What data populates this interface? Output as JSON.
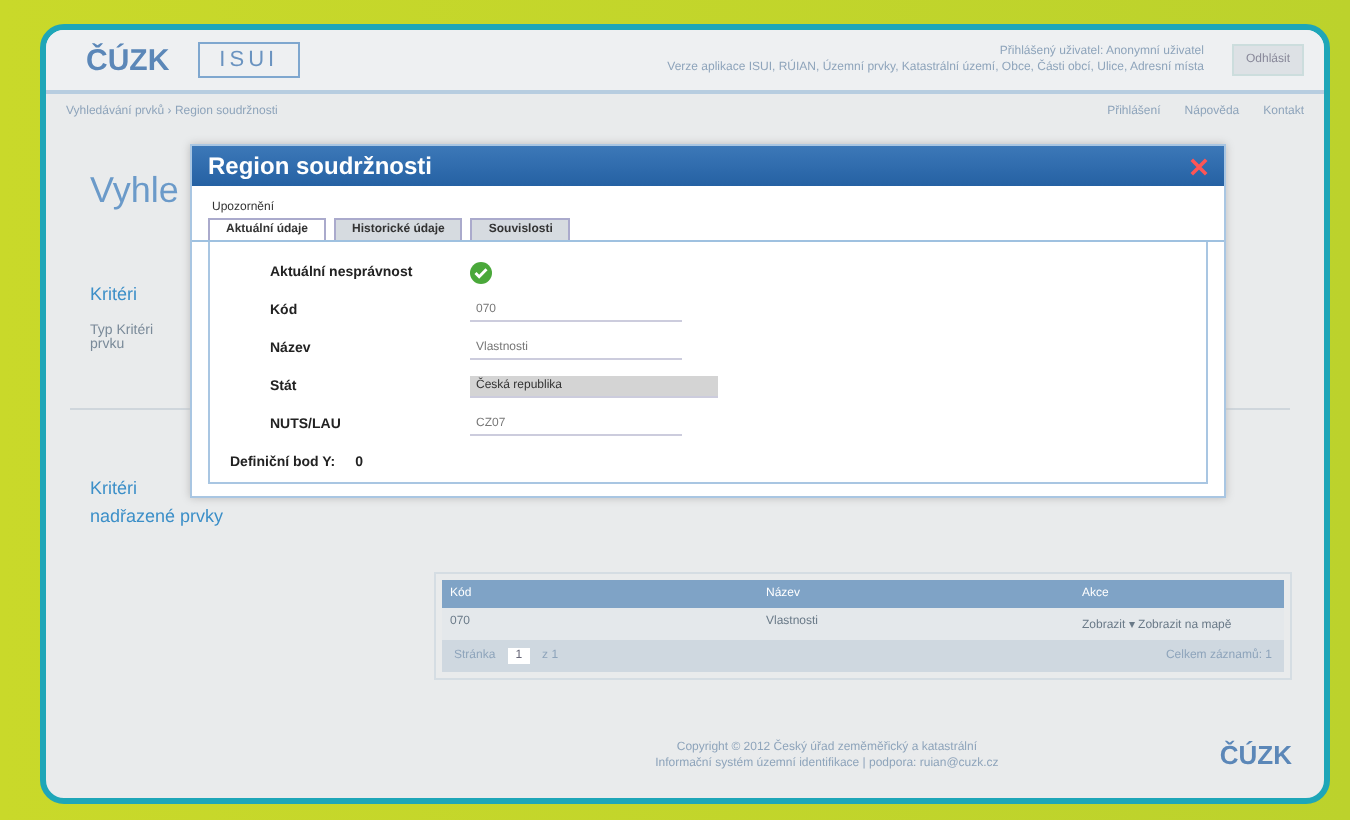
{
  "header": {
    "logo": "ČÚZK",
    "app": "ISUI",
    "info_lines": [
      "Přihlášený uživatel: Anonymní uživatel",
      "Verze aplikace ISUI, RÚIAN, Územní prvky, Katastrální území, Obce, Části obcí, Ulice, Adresní místa"
    ],
    "button": "Odhlásit"
  },
  "breadcrumb": "Vyhledávání prvků › Region soudržnosti",
  "top_links": [
    "Přihlášení",
    "Nápověda",
    "Kontakt"
  ],
  "page": {
    "title": "Vyhle",
    "criteria_link": "Kritéri",
    "criteria_text": "Typ Kritéri prvku",
    "parent_link": "Kritéri",
    "parent_text": "nadřazené prvky",
    "table": {
      "columns": [
        "Kód",
        "Název",
        "Akce"
      ],
      "rows": [
        {
          "code": "070",
          "name": "Vlastnosti",
          "action": "Zobrazit",
          "caret": "▾",
          "action2": "Zobrazit na mapě"
        }
      ],
      "pager_label": "Stránka",
      "pager_value": "1",
      "pager_total": "z 1",
      "count": "Celkem záznamů: 1"
    },
    "footer": [
      "Copyright © 2012 Český úřad zeměměřický a katastrální",
      "Informační systém územní identifikace | podpora: ruian@cuzk.cz"
    ],
    "footer_logo": "ČÚZK"
  },
  "dialog": {
    "title": "Region soudržnosti",
    "notice": "Upozornění",
    "tabs": [
      {
        "label": "Aktuální údaje",
        "selected": true
      },
      {
        "label": "Historické údaje",
        "selected": false
      },
      {
        "label": "Souvislosti",
        "selected": false
      }
    ],
    "fields": [
      {
        "kind": "status",
        "label": "Aktuální nesprávnost",
        "ok": true
      },
      {
        "kind": "text",
        "label": "Kód",
        "value": "070"
      },
      {
        "kind": "text",
        "label": "Název",
        "value": "Vlastnosti"
      },
      {
        "kind": "select",
        "label": "Stát",
        "value": "Česká republika"
      },
      {
        "kind": "text",
        "label": "NUTS/LAU",
        "value": "CZ07"
      }
    ],
    "point_label": "Definiční bod Y:",
    "point_value": "0"
  }
}
